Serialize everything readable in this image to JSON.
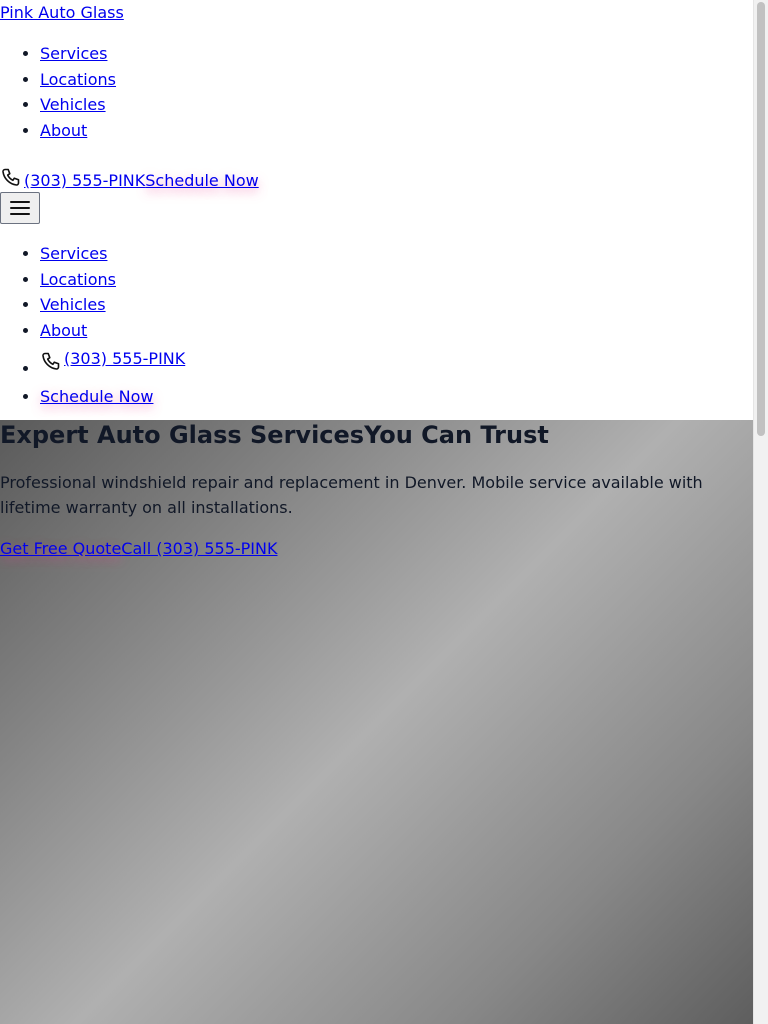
{
  "header": {
    "brand": "Pink Auto Glass",
    "nav": [
      "Services",
      "Locations",
      "Vehicles",
      "About"
    ],
    "phone_label": "(303) 555-PINK",
    "schedule_label": "Schedule Now",
    "menu_icon": "hamburger-menu-icon",
    "phone_icon": "phone-icon"
  },
  "mobile_menu": {
    "items": [
      "Services",
      "Locations",
      "Vehicles",
      "About"
    ],
    "phone_label": "(303) 555-PINK",
    "schedule_label": "Schedule Now"
  },
  "hero": {
    "title_part1": "Expert Auto Glass Services",
    "title_part2": "You Can Trust",
    "description": "Professional windshield repair and replacement in Denver. Mobile service available with lifetime warranty on all installations.",
    "cta_quote": "Get Free Quote",
    "cta_call": "Call (303) 555-PINK"
  },
  "colors": {
    "link": "#0000ee",
    "text": "#111827",
    "accent_glow": "#ec4899"
  }
}
